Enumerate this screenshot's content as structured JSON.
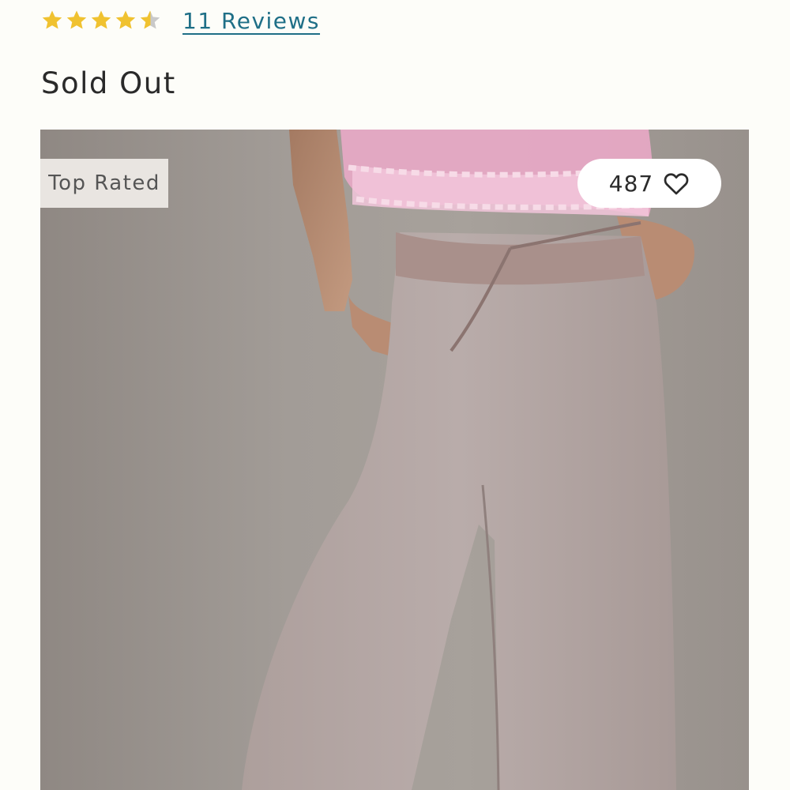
{
  "rating": {
    "value": 4.5,
    "max": 5,
    "star_color": "#f0c230",
    "empty_star_color": "#c9c9c9",
    "icon": "star-icon"
  },
  "reviews_link": "11 Reviews",
  "stock_status": "Sold Out",
  "product_image": {
    "badge": "Top Rated",
    "favorite_count": "487",
    "favorite_icon": "heart-icon"
  },
  "colors": {
    "link": "#1f6f87",
    "background": "#fdfdf9"
  }
}
